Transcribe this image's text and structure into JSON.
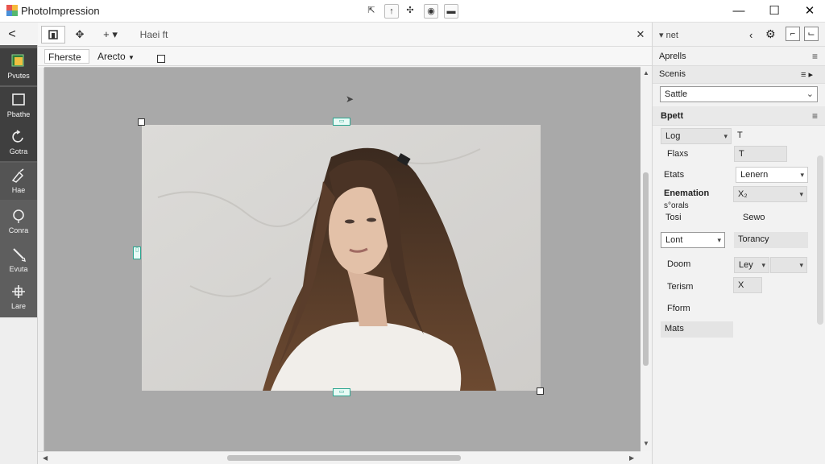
{
  "app": {
    "title": "PhotoImpression"
  },
  "titlebar_icons": [
    "share-icon",
    "upload-icon",
    "adjust-icon",
    "settings-icon",
    "minimize-panel-icon"
  ],
  "window": {
    "minimize": "—",
    "maximize": "☐",
    "close": "✕"
  },
  "toolbar": {
    "back": "<",
    "hand_label": "Haei ft",
    "close": "✕"
  },
  "options": {
    "preset_dropdown": "Fherste",
    "aspect_dropdown": "Arecto"
  },
  "tools": [
    {
      "label": "Pvutes",
      "icon": "layers-icon",
      "selected": true
    },
    {
      "label": "Pbathe",
      "icon": "crop-icon",
      "selected": true
    },
    {
      "label": "Gotra",
      "icon": "rotate-icon",
      "selected": true
    },
    {
      "label": "Hae",
      "icon": "brush-icon",
      "selected": true
    },
    {
      "label": "Conra",
      "icon": "lasso-icon",
      "selected": false
    },
    {
      "label": "Evuta",
      "icon": "pen-icon",
      "selected": false
    },
    {
      "label": "Lare",
      "icon": "transform-icon",
      "selected": false
    }
  ],
  "panel": {
    "header_label": "▾ net",
    "tabs": [
      "Aprells",
      "Scenis"
    ],
    "style_select": "Sattle",
    "section_title": "Bpett",
    "rows": {
      "log_label": "Log",
      "t_label": "T",
      "flaxs_label": "Flaxs",
      "t_value": "T",
      "etats_label": "Etats",
      "lenern_value": "Lenern",
      "enemation_label": "Enemation",
      "x2_value": "X₂",
      "sorals_label": "s°orals",
      "tosi_label": "Tosi",
      "sewo_label": "Sewo",
      "lont_value": "Lont",
      "toranc_value": "Torancy",
      "dosm_label": "Doom",
      "ley_value": "Ley",
      "terism_label": "Terism",
      "x_value": "X",
      "fform_label": "Fform",
      "mats_label": "Mats"
    }
  },
  "colors": {
    "rail_dark": "#5e5e5e",
    "canvas_bg": "#a9a9a9",
    "handle_teal": "#2aa58f"
  }
}
